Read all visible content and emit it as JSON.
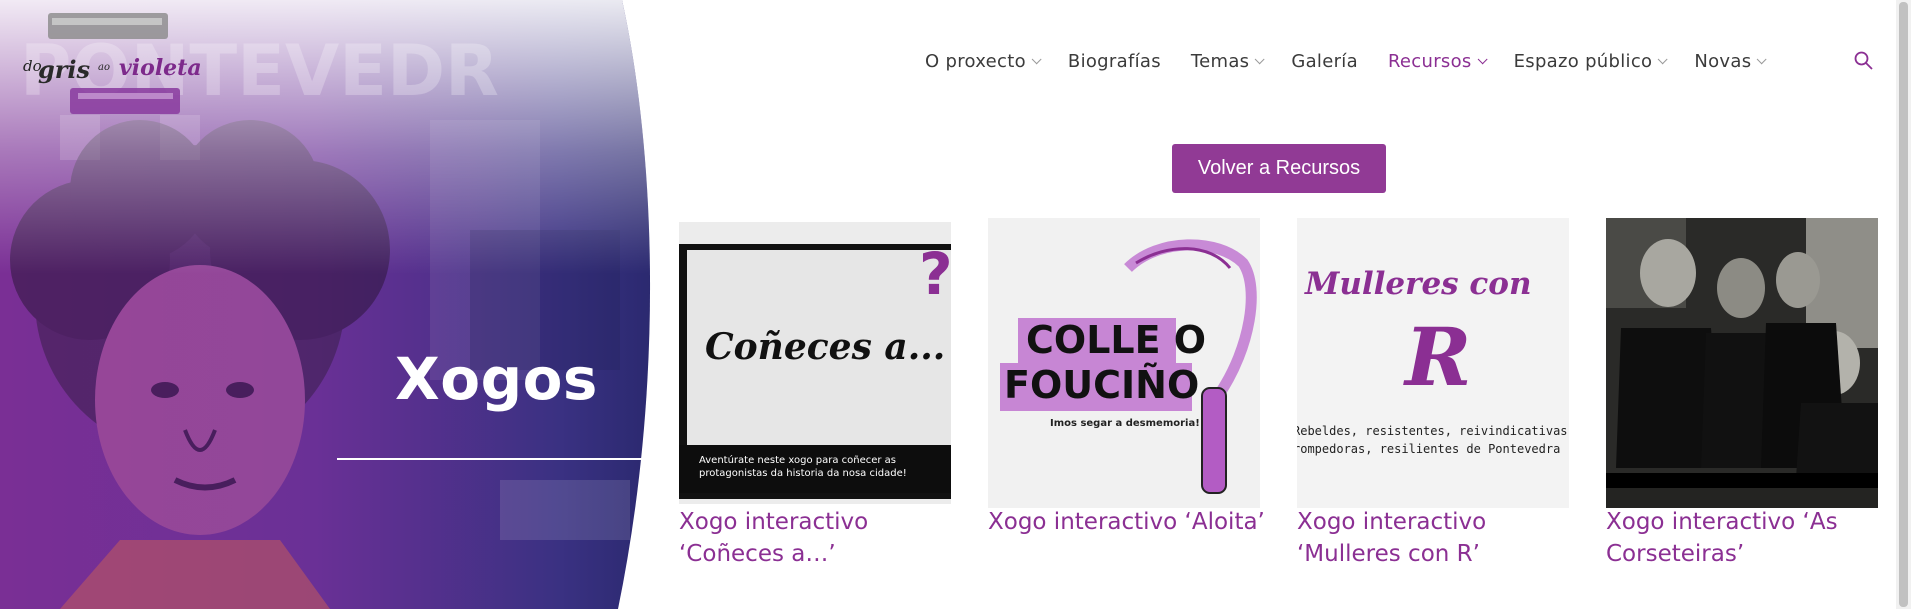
{
  "logo": {
    "line1": "do",
    "line2": "gris",
    "line3": "ao",
    "line4": "violeta"
  },
  "hero": {
    "title": "Xogos"
  },
  "nav": {
    "items": [
      {
        "label": "O proxecto",
        "dropdown": true,
        "active": false
      },
      {
        "label": "Biografías",
        "dropdown": false,
        "active": false
      },
      {
        "label": "Temas",
        "dropdown": true,
        "active": false
      },
      {
        "label": "Galería",
        "dropdown": false,
        "active": false
      },
      {
        "label": "Recursos",
        "dropdown": true,
        "active": true
      },
      {
        "label": "Espazo público",
        "dropdown": true,
        "active": false
      },
      {
        "label": "Novas",
        "dropdown": true,
        "active": false
      }
    ],
    "search_icon": "search-icon"
  },
  "back_button": {
    "label": "Volver a Recursos"
  },
  "cards": [
    {
      "title": "Xogo interactivo ‘Coñeces a…’",
      "image_heading": "Coñeces a...",
      "image_mark": "?",
      "image_caption": "Aventúrate neste xogo para coñecer as protagonistas da historia da nosa cidade!"
    },
    {
      "title": "Xogo interactivo ‘Aloita’",
      "image_line1": "COLLE O",
      "image_line2": "FOUCIÑO",
      "image_caption": "Imos segar a desmemoria!"
    },
    {
      "title": "Xogo interactivo ‘Mulleres con R’",
      "image_heading": "Mulleres con",
      "image_letter": "R",
      "image_caption_1": "Rebeldes, resistentes, reivindicativas,",
      "image_caption_2": "rompedoras, resilientes de Pontevedra"
    },
    {
      "title": "Xogo interactivo ‘As Corseteiras’"
    }
  ],
  "colors": {
    "accent": "#8b2f93",
    "button": "#913a95",
    "hero_purple": "#6b2a8a",
    "hero_navy": "#2b2a6e"
  }
}
